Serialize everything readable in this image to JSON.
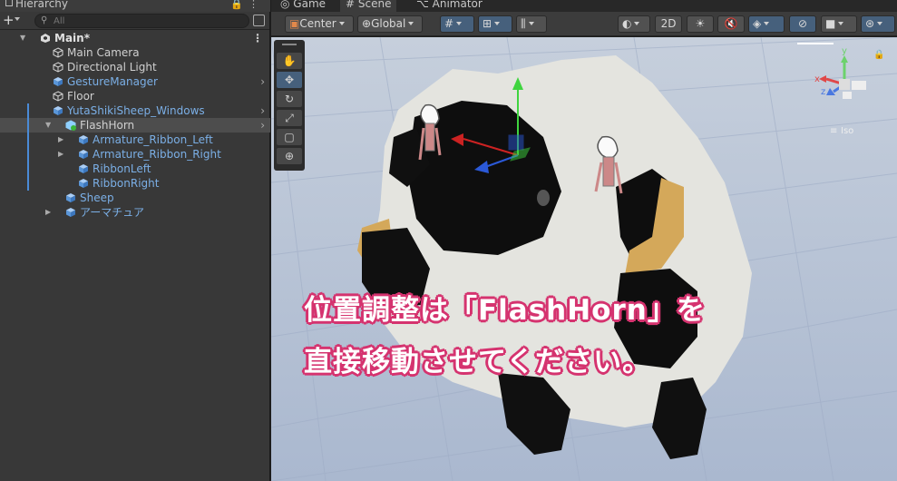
{
  "hierarchy": {
    "tab_label": "Hierarchy",
    "search_placeholder": "All",
    "items": [
      {
        "label": "Main*",
        "depth": 0,
        "arrow": "▼",
        "type": "scene"
      },
      {
        "label": "Main Camera",
        "depth": 1,
        "type": "object"
      },
      {
        "label": "Directional Light",
        "depth": 1,
        "type": "object"
      },
      {
        "label": "GestureManager",
        "depth": 1,
        "type": "prefab"
      },
      {
        "label": "Floor",
        "depth": 1,
        "type": "object"
      },
      {
        "label": "YutaShikiSheep_Windows",
        "depth": 1,
        "type": "prefab"
      },
      {
        "label": "FlashHorn",
        "depth": 2,
        "arrow": "▼",
        "type": "object",
        "selected": true
      },
      {
        "label": "Armature_Ribbon_Left",
        "depth": 3,
        "arrow": "▶",
        "type": "prefab"
      },
      {
        "label": "Armature_Ribbon_Right",
        "depth": 3,
        "arrow": "▶",
        "type": "prefab"
      },
      {
        "label": "RibbonLeft",
        "depth": 3,
        "type": "prefab"
      },
      {
        "label": "RibbonRight",
        "depth": 3,
        "type": "prefab"
      },
      {
        "label": "Sheep",
        "depth": 2,
        "type": "prefab"
      },
      {
        "label": "アーマチュア",
        "depth": 2,
        "arrow": "▶",
        "type": "prefab"
      }
    ]
  },
  "scene": {
    "tabs": [
      {
        "label": "Game",
        "icon": "gamepad-icon"
      },
      {
        "label": "Scene",
        "icon": "grid-icon"
      },
      {
        "label": "Animator",
        "icon": "animator-icon"
      }
    ],
    "pivot_label": "Center",
    "space_label": "Global",
    "mode_2d_label": "2D",
    "gizmo_view_label": "Iso",
    "gizmo_axes": {
      "x": "x",
      "y": "y",
      "z": "z"
    }
  },
  "caption": {
    "line1": "位置調整は「FlashHorn」を",
    "line2": "直接移動させてください。"
  },
  "colors": {
    "selection": "#4d4d4d",
    "prefab_text": "#7bafe6",
    "caption_outline": "#d5336f",
    "viewport_bg": "#b9c4d6"
  }
}
